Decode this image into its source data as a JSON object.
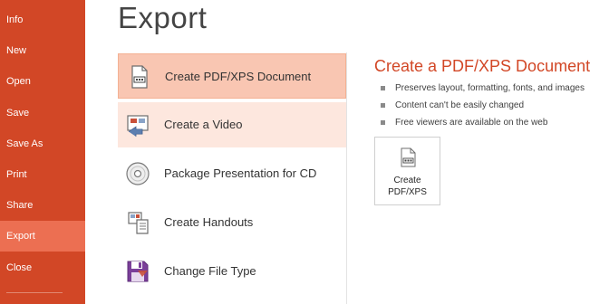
{
  "nav": {
    "items": [
      {
        "label": "Info"
      },
      {
        "label": "New"
      },
      {
        "label": "Open"
      },
      {
        "label": "Save"
      },
      {
        "label": "Save As"
      },
      {
        "label": "Print"
      },
      {
        "label": "Share"
      },
      {
        "label": "Export"
      },
      {
        "label": "Close"
      }
    ],
    "active": "Export",
    "background_color": "#d24726",
    "active_color": "#ec6f52"
  },
  "page": {
    "title": "Export"
  },
  "options": [
    {
      "label": "Create PDF/XPS Document",
      "icon": "pdf-document-icon",
      "state": "selected"
    },
    {
      "label": "Create a Video",
      "icon": "video-icon",
      "state": "hover"
    },
    {
      "label": "Package Presentation for CD",
      "icon": "cd-icon",
      "state": "normal"
    },
    {
      "label": "Create Handouts",
      "icon": "handouts-icon",
      "state": "normal"
    },
    {
      "label": "Change File Type",
      "icon": "save-disk-icon",
      "state": "normal"
    }
  ],
  "detail": {
    "title": "Create a PDF/XPS Document",
    "bullets": [
      "Preserves layout, formatting, fonts, and images",
      "Content can't be easily changed",
      "Free viewers are available on the web"
    ],
    "button_label": "Create\nPDF/XPS",
    "button_icon": "pdf-document-icon"
  },
  "colors": {
    "accent": "#d24726",
    "selected_bg": "#f9c6b2",
    "hover_bg": "#fde7de"
  }
}
